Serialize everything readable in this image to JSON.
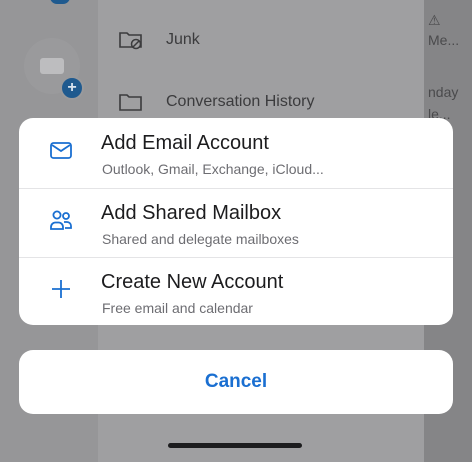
{
  "background": {
    "folders": [
      {
        "label": "Junk",
        "icon": "junk-folder-icon"
      },
      {
        "label": "Conversation History",
        "icon": "folder-icon"
      }
    ],
    "right_snippets": [
      "⚠",
      "Me...",
      "nday",
      "le..."
    ]
  },
  "action_sheet": {
    "options": [
      {
        "title": "Add Email Account",
        "subtitle": "Outlook, Gmail, Exchange, iCloud...",
        "icon": "envelope-icon"
      },
      {
        "title": "Add Shared Mailbox",
        "subtitle": "Shared and delegate mailboxes",
        "icon": "people-icon"
      },
      {
        "title": "Create New Account",
        "subtitle": "Free email and calendar",
        "icon": "plus-icon"
      }
    ],
    "cancel_label": "Cancel"
  },
  "colors": {
    "accent": "#1a6fd1",
    "badge": "#1f5a8f"
  }
}
